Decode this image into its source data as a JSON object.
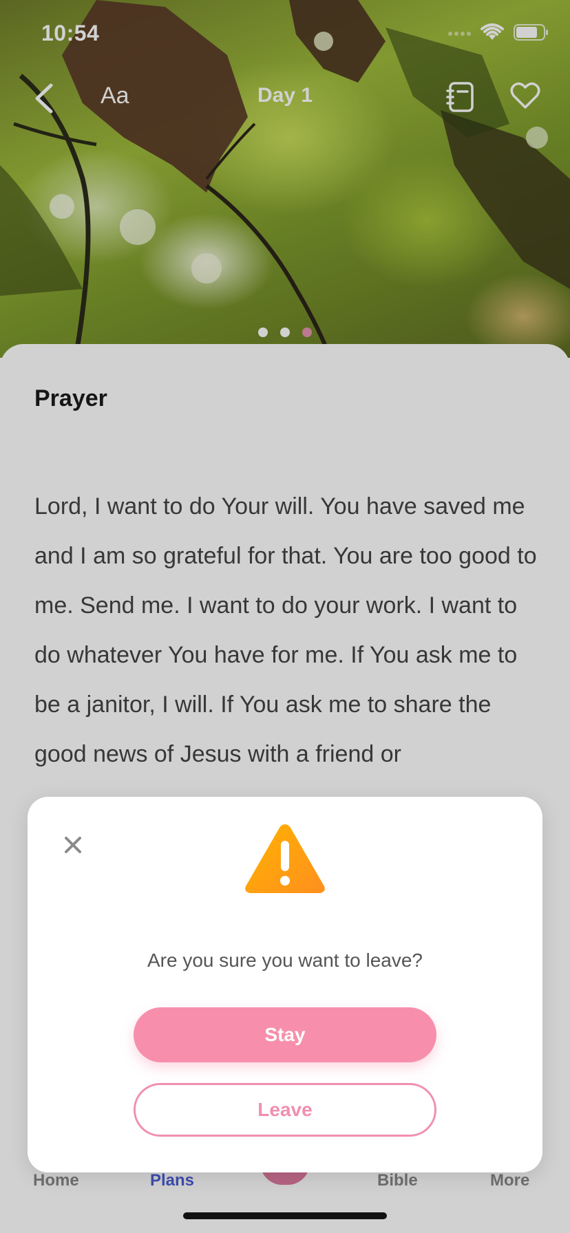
{
  "status_bar": {
    "time": "10:54"
  },
  "nav": {
    "font_size_label": "Aa",
    "title": "Day 1"
  },
  "pager": {
    "count": 3,
    "active_index": 2
  },
  "content": {
    "section_title": "Prayer",
    "body": "Lord, I want to do Your will. You have saved me and I am so grateful for that. You are too good to me. Send me. I want to do your work. I want to do whatever You have for me. If You ask me to be a janitor, I will. If You ask me to share the good news of Jesus with a friend or"
  },
  "tab_bar": {
    "items": [
      {
        "label": "Home"
      },
      {
        "label": "Plans"
      },
      {
        "label": ""
      },
      {
        "label": "Bible"
      },
      {
        "label": "More"
      }
    ]
  },
  "dialog": {
    "message": "Are you sure you want to leave?",
    "stay_label": "Stay",
    "leave_label": "Leave"
  },
  "colors": {
    "accent_pink": "#f78fac",
    "active_tab": "#4b5fd6",
    "warning_orange": "#ffa31a"
  }
}
